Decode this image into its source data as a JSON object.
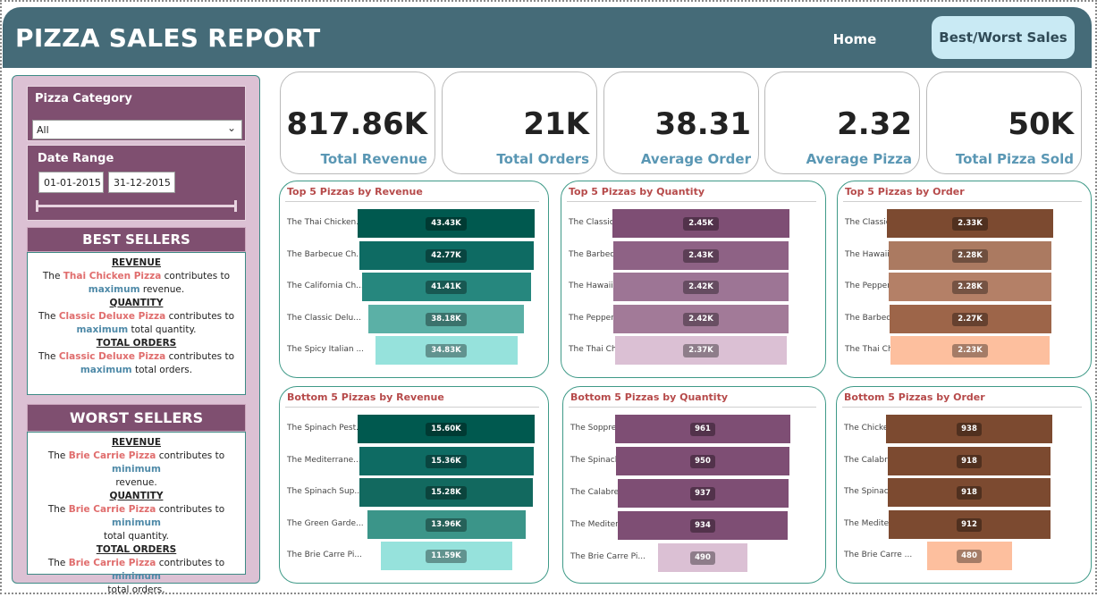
{
  "header": {
    "title": "PIZZA SALES REPORT",
    "nav_home": "Home",
    "nav_best_worst": "Best/Worst Sales"
  },
  "filters": {
    "category_label": "Pizza Category",
    "category_value": "All",
    "date_label": "Date Range",
    "date_start": "01-01-2015",
    "date_end": "31-12-2015"
  },
  "best_sellers": {
    "title": "BEST SELLERS",
    "revenue_head": "REVENUE",
    "revenue_pre": "The ",
    "revenue_pizza": "Thai Chicken Pizza",
    "revenue_mid": " contributes to ",
    "revenue_key": "maximum",
    "revenue_post": " revenue.",
    "quantity_head": "QUANTITY",
    "quantity_pre": "The ",
    "quantity_pizza": "Classic Deluxe Pizza",
    "quantity_mid": " contributes to ",
    "quantity_key": "maximum",
    "quantity_post": " total quantity.",
    "orders_head": "TOTAL ORDERS",
    "orders_pre": "The ",
    "orders_pizza": "Classic Deluxe Pizza",
    "orders_mid": " contributes to ",
    "orders_key": "maximum",
    "orders_post": " total orders."
  },
  "worst_sellers": {
    "title": "WORST SELLERS",
    "revenue_head": "REVENUE",
    "revenue_pre": "The ",
    "revenue_pizza": "Brie Carrie Pizza",
    "revenue_mid": " contributes to ",
    "revenue_key": "minimum",
    "revenue_post": " revenue.",
    "quantity_head": "QUANTITY",
    "quantity_pre": "The ",
    "quantity_pizza": "Brie Carrie Pizza",
    "quantity_mid": " contributes to ",
    "quantity_key": "minimum",
    "quantity_post": " total quantity.",
    "orders_head": "TOTAL ORDERS",
    "orders_pre": "The ",
    "orders_pizza": "Brie Carrie Pizza",
    "orders_mid": " contributes to ",
    "orders_key": "minimum",
    "orders_post": " total orders."
  },
  "kpis": [
    {
      "value": "817.86K",
      "label": "Total Revenue"
    },
    {
      "value": "21K",
      "label": "Total Orders"
    },
    {
      "value": "38.31",
      "label": "Average Order"
    },
    {
      "value": "2.32",
      "label": "Average Pizza"
    },
    {
      "value": "50K",
      "label": "Total Pizza Sold"
    }
  ],
  "chart_data": [
    {
      "type": "bar",
      "title": "Top 5 Pizzas by Revenue",
      "categories": [
        "The Thai Chicken...",
        "The Barbecue Ch...",
        "The California Ch...",
        "The Classic Delu...",
        "The Spicy Italian ..."
      ],
      "values": [
        43430,
        42770,
        41410,
        38180,
        34830
      ],
      "labels": [
        "43.43K",
        "42.77K",
        "41.41K",
        "38.18K",
        "34.83K"
      ],
      "colors": [
        "#00594f",
        "#0e6b63",
        "#26877e",
        "#5bb0a6",
        "#96e2dc"
      ]
    },
    {
      "type": "bar",
      "title": "Top 5 Pizzas by Quantity",
      "categories": [
        "The Classic Delu...",
        "The Barbecue Ch...",
        "The Hawaiian Piz...",
        "The Pepperoni Pi...",
        "The Thai Chicken..."
      ],
      "values": [
        2450,
        2430,
        2420,
        2420,
        2370
      ],
      "labels": [
        "2.45K",
        "2.43K",
        "2.42K",
        "2.42K",
        "2.37K"
      ],
      "colors": [
        "#7e4e74",
        "#8e6285",
        "#9d7595",
        "#a27a98",
        "#dbc0d4"
      ]
    },
    {
      "type": "bar",
      "title": "Top 5 Pizzas by Order",
      "categories": [
        "The Classic Delu...",
        "The Hawaiian Pi...",
        "The Pepperoni P...",
        "The Barbecue C...",
        "The Thai Chicke..."
      ],
      "values": [
        2330,
        2280,
        2280,
        2270,
        2230
      ],
      "labels": [
        "2.33K",
        "2.28K",
        "2.28K",
        "2.27K",
        "2.23K"
      ],
      "colors": [
        "#7c4a30",
        "#ab7a61",
        "#b48067",
        "#9d6549",
        "#fdbf9e"
      ]
    },
    {
      "type": "bar",
      "title": "Bottom 5 Pizzas by Revenue",
      "categories": [
        "The Spinach Pest...",
        "The Mediterrane...",
        "The Spinach Sup...",
        "The Green Garde...",
        "The Brie Carre Pi..."
      ],
      "values": [
        15600,
        15360,
        15280,
        13960,
        11590
      ],
      "labels": [
        "15.60K",
        "15.36K",
        "15.28K",
        "13.96K",
        "11.59K"
      ],
      "colors": [
        "#00594f",
        "#0e6b63",
        "#12695f",
        "#3b9589",
        "#96e2dc"
      ]
    },
    {
      "type": "bar",
      "title": "Bottom 5 Pizzas by Quantity",
      "categories": [
        "The Soppressata...",
        "The Spinach Sup...",
        "The Calabrese Pi...",
        "The Mediterrane...",
        "The Brie Carre Pi..."
      ],
      "values": [
        961,
        950,
        937,
        934,
        490
      ],
      "labels": [
        "961",
        "950",
        "937",
        "934",
        "490"
      ],
      "colors": [
        "#7e4e74",
        "#7e4e74",
        "#7e4e74",
        "#7e4e74",
        "#dbc0d4"
      ]
    },
    {
      "type": "bar",
      "title": "Bottom 5 Pizzas by Order",
      "categories": [
        "The Chicken Pes...",
        "The Calabrese P...",
        "The Spinach Sup...",
        "The Mediterrane...",
        "The Brie Carre ..."
      ],
      "values": [
        938,
        918,
        918,
        912,
        480
      ],
      "labels": [
        "938",
        "918",
        "918",
        "912",
        "480"
      ],
      "colors": [
        "#7c4a30",
        "#7c4a30",
        "#7c4a30",
        "#7c4a30",
        "#fdbf9e"
      ]
    }
  ]
}
